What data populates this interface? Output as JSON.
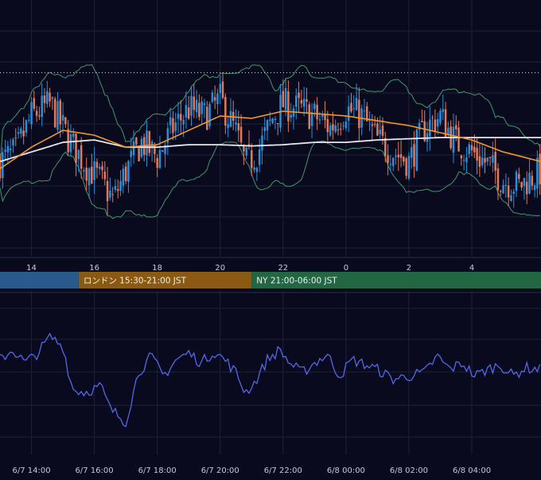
{
  "colors": {
    "background": "#0a0a1e",
    "grid": "#1f2238",
    "axis_divider": "#2a2d48",
    "candle_up": "#2b8fd8",
    "candle_down": "#e07a5f",
    "ma_short": "#f0962c",
    "ma_long": "#e8e8f0",
    "bollinger": "#4caf7a",
    "oscillator": "#5566e8",
    "tick_text": "#c8c8d8",
    "session_tokyo": "#2a5a8c",
    "session_london": "#8a5a12",
    "session_ny": "#226644",
    "session_text": "#eeeeee"
  },
  "sessions": [
    {
      "label": "",
      "start_hour": 13.0,
      "end_hour": 15.5
    },
    {
      "label": "ロンドン 15:30-21:00 JST",
      "start_hour": 15.5,
      "end_hour": 21.0
    },
    {
      "label": "NY 21:00-06:00 JST",
      "start_hour": 21.0,
      "end_hour": 30.2
    }
  ],
  "chart_data": [
    {
      "type": "candlestick",
      "time_axis": "hours_jst_continuous",
      "x_range": [
        13.0,
        30.2
      ],
      "y_range": [
        0,
        100
      ],
      "price_tick_labels": [],
      "x_tick_labels": [
        "14",
        "16",
        "18",
        "20",
        "22",
        "0",
        "2",
        "4"
      ],
      "x_tick_hours": [
        14,
        16,
        18,
        20,
        22,
        24,
        26,
        28
      ],
      "reference_line": 73,
      "grid": true,
      "legend": "none",
      "series": [
        {
          "name": "",
          "kind": "ohlc",
          "candle_interval_minutes": 5
        },
        {
          "name": "",
          "kind": "moving_average",
          "role": "short"
        },
        {
          "name": "",
          "kind": "moving_average",
          "role": "long"
        },
        {
          "name": "",
          "kind": "bollinger_band"
        }
      ],
      "anchors": {
        "close": [
          [
            13,
            36
          ],
          [
            13.5,
            40
          ],
          [
            14,
            55
          ],
          [
            14.6,
            60
          ],
          [
            15.2,
            45
          ],
          [
            15.7,
            35
          ],
          [
            16.2,
            28
          ],
          [
            16.6,
            20
          ],
          [
            17,
            32
          ],
          [
            17.5,
            44
          ],
          [
            18,
            38
          ],
          [
            18.5,
            50
          ],
          [
            19,
            58
          ],
          [
            19.5,
            55
          ],
          [
            20,
            62
          ],
          [
            20.5,
            48
          ],
          [
            20.8,
            35
          ],
          [
            21.2,
            40
          ],
          [
            21.7,
            55
          ],
          [
            22,
            60
          ],
          [
            22.5,
            58
          ],
          [
            23,
            55
          ],
          [
            23.5,
            50
          ],
          [
            24,
            58
          ],
          [
            24.5,
            55
          ],
          [
            25,
            45
          ],
          [
            25.5,
            40
          ],
          [
            26,
            36
          ],
          [
            26.5,
            50
          ],
          [
            27,
            55
          ],
          [
            27.5,
            44
          ],
          [
            28,
            40
          ],
          [
            28.5,
            35
          ],
          [
            29,
            28
          ],
          [
            29.5,
            26
          ],
          [
            30.2,
            32
          ]
        ],
        "ma_short": [
          [
            13,
            33
          ],
          [
            14,
            42
          ],
          [
            15,
            49
          ],
          [
            16,
            47
          ],
          [
            17,
            42
          ],
          [
            18,
            43
          ],
          [
            19,
            49
          ],
          [
            20,
            55
          ],
          [
            21,
            54
          ],
          [
            22,
            57
          ],
          [
            23,
            56
          ],
          [
            24,
            55
          ],
          [
            25,
            53
          ],
          [
            26,
            51
          ],
          [
            27,
            48
          ],
          [
            28,
            45
          ],
          [
            29,
            40
          ],
          [
            30.2,
            36
          ]
        ],
        "ma_long": [
          [
            13,
            36
          ],
          [
            15,
            44
          ],
          [
            16,
            45
          ],
          [
            17,
            42
          ],
          [
            18,
            42
          ],
          [
            19,
            43
          ],
          [
            20,
            43
          ],
          [
            21,
            42.5
          ],
          [
            22,
            43
          ],
          [
            23,
            44
          ],
          [
            24,
            44
          ],
          [
            25,
            45
          ],
          [
            26,
            45.5
          ],
          [
            27,
            46
          ],
          [
            28,
            46
          ],
          [
            29,
            46
          ],
          [
            30.2,
            46
          ]
        ]
      }
    },
    {
      "type": "line",
      "x_range": [
        13.0,
        30.2
      ],
      "y_range": [
        0,
        100
      ],
      "x_tick_labels": [
        "6/7 14:00",
        "6/7 16:00",
        "6/7 18:00",
        "6/7 20:00",
        "6/7 22:00",
        "6/8 00:00",
        "6/8 02:00",
        "6/8 04:00"
      ],
      "x_tick_hours": [
        14,
        16,
        18,
        20,
        22,
        24,
        26,
        28
      ],
      "grid": true,
      "legend": "none",
      "series": [
        {
          "name": "",
          "anchors": [
            [
              13,
              58
            ],
            [
              13.4,
              64
            ],
            [
              13.8,
              56
            ],
            [
              14.2,
              62
            ],
            [
              14.6,
              72
            ],
            [
              15,
              66
            ],
            [
              15.3,
              40
            ],
            [
              15.7,
              38
            ],
            [
              16.2,
              42
            ],
            [
              16.5,
              28
            ],
            [
              17,
              20
            ],
            [
              17.4,
              50
            ],
            [
              17.8,
              60
            ],
            [
              18.2,
              48
            ],
            [
              18.6,
              58
            ],
            [
              19,
              62
            ],
            [
              19.4,
              56
            ],
            [
              19.8,
              63
            ],
            [
              20.2,
              57
            ],
            [
              20.5,
              50
            ],
            [
              20.8,
              38
            ],
            [
              21.1,
              44
            ],
            [
              21.5,
              58
            ],
            [
              21.9,
              64
            ],
            [
              22.2,
              56
            ],
            [
              22.6,
              50
            ],
            [
              23,
              56
            ],
            [
              23.4,
              61
            ],
            [
              23.8,
              48
            ],
            [
              24.2,
              58
            ],
            [
              24.6,
              55
            ],
            [
              25,
              52
            ],
            [
              25.5,
              46
            ],
            [
              26,
              48
            ],
            [
              26.5,
              50
            ],
            [
              26.9,
              60
            ],
            [
              27.3,
              52
            ],
            [
              27.7,
              56
            ],
            [
              28.1,
              48
            ],
            [
              28.5,
              52
            ],
            [
              28.9,
              55
            ],
            [
              29.3,
              48
            ],
            [
              29.7,
              53
            ],
            [
              30.2,
              52
            ]
          ]
        }
      ]
    }
  ]
}
